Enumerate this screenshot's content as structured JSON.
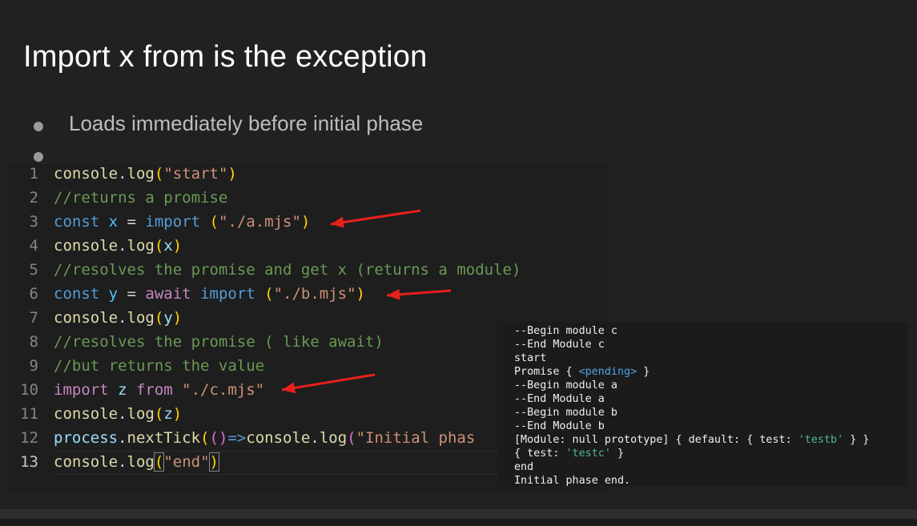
{
  "slide": {
    "title": "Import x from is the exception",
    "bullets": [
      "Loads immediately before initial phase",
      ""
    ]
  },
  "code": {
    "lines": [
      {
        "n": "1",
        "tokens": [
          [
            "fn",
            "console"
          ],
          [
            "pu",
            "."
          ],
          [
            "fn",
            "log"
          ],
          [
            "br1",
            "("
          ],
          [
            "str",
            "\"start\""
          ],
          [
            "br1",
            ")"
          ]
        ]
      },
      {
        "n": "2",
        "tokens": [
          [
            "cm",
            "//returns a promise"
          ]
        ]
      },
      {
        "n": "3",
        "tokens": [
          [
            "kw",
            "const "
          ],
          [
            "var",
            "x"
          ],
          [
            "pu",
            " = "
          ],
          [
            "kw",
            "import "
          ],
          [
            "br1",
            "("
          ],
          [
            "str",
            "\"./a.mjs\""
          ],
          [
            "br1",
            ")"
          ]
        ]
      },
      {
        "n": "4",
        "tokens": [
          [
            "fn",
            "console"
          ],
          [
            "pu",
            "."
          ],
          [
            "fn",
            "log"
          ],
          [
            "br1",
            "("
          ],
          [
            "obj",
            "x"
          ],
          [
            "br1",
            ")"
          ]
        ]
      },
      {
        "n": "5",
        "tokens": [
          [
            "cm",
            "//resolves the promise and get x (returns a module)"
          ]
        ]
      },
      {
        "n": "6",
        "tokens": [
          [
            "kw",
            "const "
          ],
          [
            "var",
            "y"
          ],
          [
            "pu",
            " = "
          ],
          [
            "ctl",
            "await "
          ],
          [
            "kw",
            "import "
          ],
          [
            "br1",
            "("
          ],
          [
            "str",
            "\"./b.mjs\""
          ],
          [
            "br1",
            ")"
          ]
        ]
      },
      {
        "n": "7",
        "tokens": [
          [
            "fn",
            "console"
          ],
          [
            "pu",
            "."
          ],
          [
            "fn",
            "log"
          ],
          [
            "br1",
            "("
          ],
          [
            "obj",
            "y"
          ],
          [
            "br1",
            ")"
          ]
        ]
      },
      {
        "n": "8",
        "tokens": [
          [
            "cm",
            "//resolves the promise ( like await)"
          ]
        ]
      },
      {
        "n": "9",
        "tokens": [
          [
            "cm",
            "//but returns the value"
          ]
        ]
      },
      {
        "n": "10",
        "tokens": [
          [
            "ctl",
            "import "
          ],
          [
            "obj",
            "z "
          ],
          [
            "ctl",
            "from "
          ],
          [
            "str",
            "\"./c.mjs\""
          ]
        ]
      },
      {
        "n": "11",
        "tokens": [
          [
            "fn",
            "console"
          ],
          [
            "pu",
            "."
          ],
          [
            "fn",
            "log"
          ],
          [
            "br1",
            "("
          ],
          [
            "obj",
            "z"
          ],
          [
            "br1",
            ")"
          ]
        ]
      },
      {
        "n": "12",
        "tokens": [
          [
            "obj",
            "process"
          ],
          [
            "pu",
            "."
          ],
          [
            "fn",
            "nextTick"
          ],
          [
            "br1",
            "("
          ],
          [
            "br2",
            "()"
          ],
          [
            "kw",
            "=>"
          ],
          [
            "fn",
            "console"
          ],
          [
            "pu",
            "."
          ],
          [
            "fn",
            "log"
          ],
          [
            "br2",
            "("
          ],
          [
            "str",
            "\"Initial phas"
          ]
        ]
      },
      {
        "n": "13",
        "active": true,
        "tokens": [
          [
            "fn",
            "console"
          ],
          [
            "pu",
            "."
          ],
          [
            "fn",
            "log"
          ],
          [
            "br1",
            "(",
            true
          ],
          [
            "str",
            "\"end\""
          ],
          [
            "br1",
            ")",
            true
          ]
        ]
      }
    ]
  },
  "terminal": {
    "lines": [
      [
        [
          "t",
          "--Begin module c"
        ]
      ],
      [
        [
          "t",
          "--End Module c"
        ]
      ],
      [
        [
          "t",
          "start"
        ]
      ],
      [
        [
          "t",
          "Promise { "
        ],
        [
          "blue",
          "<pending>"
        ],
        [
          "t",
          " }"
        ]
      ],
      [
        [
          "t",
          "--Begin module a"
        ]
      ],
      [
        [
          "t",
          "--End Module a"
        ]
      ],
      [
        [
          "t",
          "--Begin module b"
        ]
      ],
      [
        [
          "t",
          "--End Module b"
        ]
      ],
      [
        [
          "t",
          "[Module: null prototype] { default: { test: "
        ],
        [
          "green",
          "'testb'"
        ],
        [
          "t",
          " } }"
        ]
      ],
      [
        [
          "t",
          "{ test: "
        ],
        [
          "green",
          "'testc'"
        ],
        [
          "t",
          " }"
        ]
      ],
      [
        [
          "t",
          "end"
        ]
      ],
      [
        [
          "t",
          "Initial phase end."
        ]
      ]
    ]
  },
  "colors": {
    "arrow": "#e8201c",
    "background": "#212121"
  }
}
